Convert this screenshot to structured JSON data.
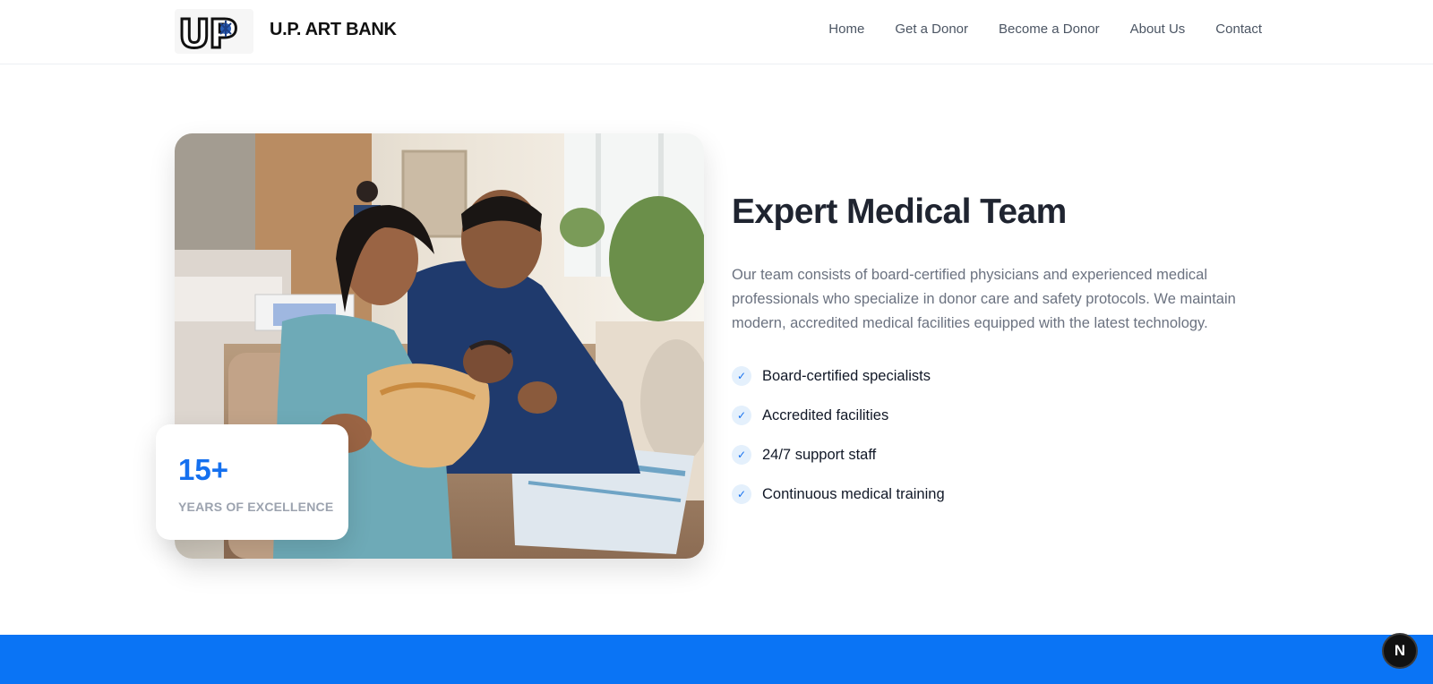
{
  "header": {
    "brand": "U.P. ART BANK",
    "logo_text": "UP",
    "nav": [
      {
        "label": "Home"
      },
      {
        "label": "Get a Donor"
      },
      {
        "label": "Become a Donor"
      },
      {
        "label": "About Us"
      },
      {
        "label": "Contact"
      }
    ]
  },
  "section": {
    "image_icon": "family-photo",
    "stat": {
      "value": "15+",
      "label": "YEARS OF EXCELLENCE"
    },
    "title": "Expert Medical Team",
    "description": "Our team consists of board-certified physicians and experienced medical professionals who specialize in donor care and safety protocols. We maintain modern, accredited medical facilities equipped with the latest technology.",
    "check_icon": "✓",
    "features": [
      {
        "label": "Board-certified specialists"
      },
      {
        "label": "Accredited facilities"
      },
      {
        "label": "24/7 support staff"
      },
      {
        "label": "Continuous medical training"
      }
    ]
  },
  "badge": {
    "label": "N"
  },
  "colors": {
    "accent": "#1570ef",
    "band": "#0a74f5",
    "text": "#1f2430",
    "muted": "#6b7280"
  }
}
